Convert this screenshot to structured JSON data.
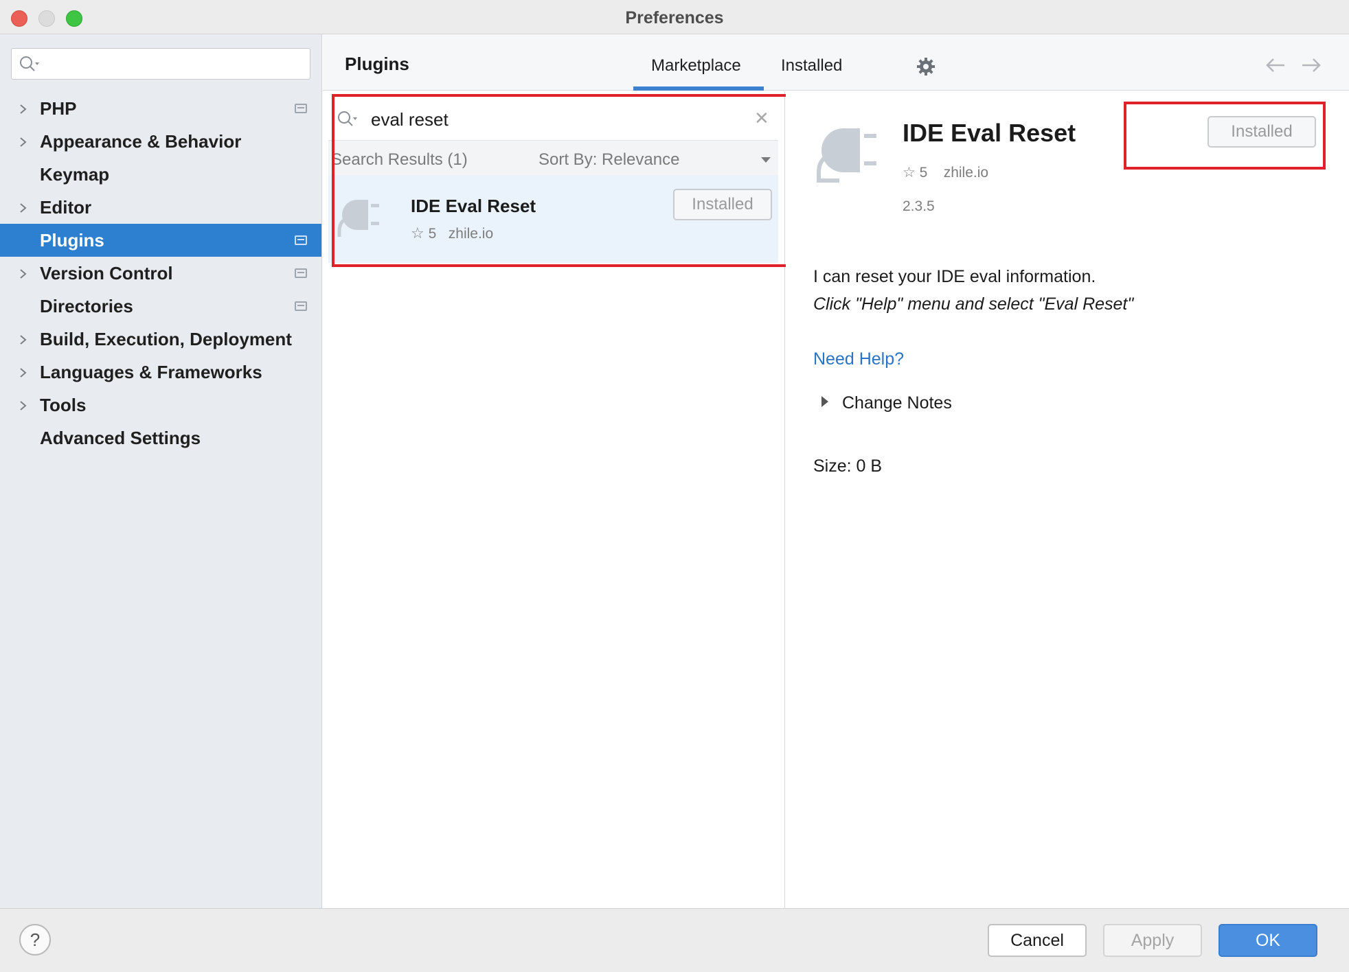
{
  "window": {
    "title": "Preferences"
  },
  "sidebar": {
    "search": {
      "placeholder": ""
    },
    "items": [
      {
        "label": "PHP",
        "expandable": true,
        "project_icon": true,
        "selected": false
      },
      {
        "label": "Appearance & Behavior",
        "expandable": true,
        "project_icon": false,
        "selected": false
      },
      {
        "label": "Keymap",
        "expandable": false,
        "project_icon": false,
        "selected": false
      },
      {
        "label": "Editor",
        "expandable": true,
        "project_icon": false,
        "selected": false
      },
      {
        "label": "Plugins",
        "expandable": false,
        "project_icon": true,
        "selected": true
      },
      {
        "label": "Version Control",
        "expandable": true,
        "project_icon": true,
        "selected": false
      },
      {
        "label": "Directories",
        "expandable": false,
        "project_icon": true,
        "selected": false
      },
      {
        "label": "Build, Execution, Deployment",
        "expandable": true,
        "project_icon": false,
        "selected": false
      },
      {
        "label": "Languages & Frameworks",
        "expandable": true,
        "project_icon": false,
        "selected": false
      },
      {
        "label": "Tools",
        "expandable": true,
        "project_icon": false,
        "selected": false
      },
      {
        "label": "Advanced Settings",
        "expandable": false,
        "project_icon": false,
        "selected": false
      }
    ]
  },
  "header": {
    "title": "Plugins",
    "tabs": [
      {
        "label": "Marketplace",
        "active": true
      },
      {
        "label": "Installed",
        "active": false
      }
    ],
    "icons": [
      "gear-icon",
      "arrow-left-icon",
      "arrow-right-icon"
    ]
  },
  "plugin_search": {
    "value": "eval reset",
    "results_label": "Search Results (1)",
    "sort_label": "Sort By: Relevance"
  },
  "results": [
    {
      "name": "IDE Eval Reset",
      "rating": "5",
      "vendor": "zhile.io",
      "button": "Installed"
    }
  ],
  "detail": {
    "name": "IDE Eval Reset",
    "rating": "5",
    "vendor": "zhile.io",
    "version": "2.3.5",
    "button": "Installed",
    "description_line1": "I can reset your IDE eval information.",
    "description_line2": "Click \"Help\" menu and select \"Eval Reset\"",
    "help_link": "Need Help?",
    "change_notes": "Change Notes",
    "size": "Size: 0 B"
  },
  "footer": {
    "help": "?",
    "cancel": "Cancel",
    "apply": "Apply",
    "ok": "OK"
  },
  "colors": {
    "accent": "#2d7fd0",
    "ok_button": "#4a8fe0",
    "highlight_box": "#e0202a",
    "link": "#2a74c4"
  }
}
